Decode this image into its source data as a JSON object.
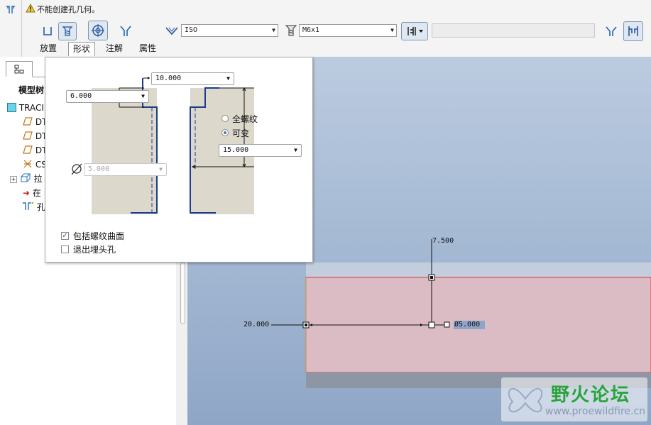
{
  "message": {
    "text": "不能创建孔几何。"
  },
  "dashboard": {
    "standard_value": "ISO",
    "screw_size_value": "M6x1",
    "depth_value": ""
  },
  "tabs": [
    {
      "label": "放置"
    },
    {
      "label": "形状"
    },
    {
      "label": "注解"
    },
    {
      "label": "属性"
    }
  ],
  "navigator": {
    "title": "模型树",
    "items": [
      {
        "label": "TRACI",
        "icon": "part-icon"
      },
      {
        "label": "DT",
        "icon": "datum-plane-icon"
      },
      {
        "label": "DT",
        "icon": "datum-plane-icon"
      },
      {
        "label": "DT",
        "icon": "datum-plane-icon"
      },
      {
        "label": "CS",
        "icon": "csys-icon"
      },
      {
        "label": "拉",
        "icon": "extrude-icon"
      },
      {
        "label": "在",
        "icon": "insert-here-icon"
      },
      {
        "label": "孔",
        "icon": "hole-icon"
      }
    ]
  },
  "shape_panel": {
    "thread_length_value": "10.000",
    "countersink_value": "6.000",
    "diameter_value": "5.000",
    "depth_value": "15.000",
    "full_thread_label": "全螺纹",
    "variable_label": "可变",
    "include_thread_surface_label": "包括螺纹曲面",
    "exit_countersink_label": "退出埋头孔",
    "full_thread_selected": false,
    "variable_selected": true,
    "include_thread_surface_checked": true,
    "exit_countersink_checked": false
  },
  "graphics": {
    "dim_offset_top": "7.500",
    "dim_offset_left": "20.000",
    "dim_diameter": "Ø5.000"
  },
  "watermark": {
    "brand": "野火论坛",
    "url": "www.proewildfire.cn"
  },
  "colors": {
    "surface_fill": "#dbbcc4",
    "surface_edge": "#e0303a",
    "background_top": "#bccbe0",
    "background_bottom": "#8fa6c6",
    "accent": "#1c3d8c",
    "watermark_green": "#2aa33a"
  }
}
